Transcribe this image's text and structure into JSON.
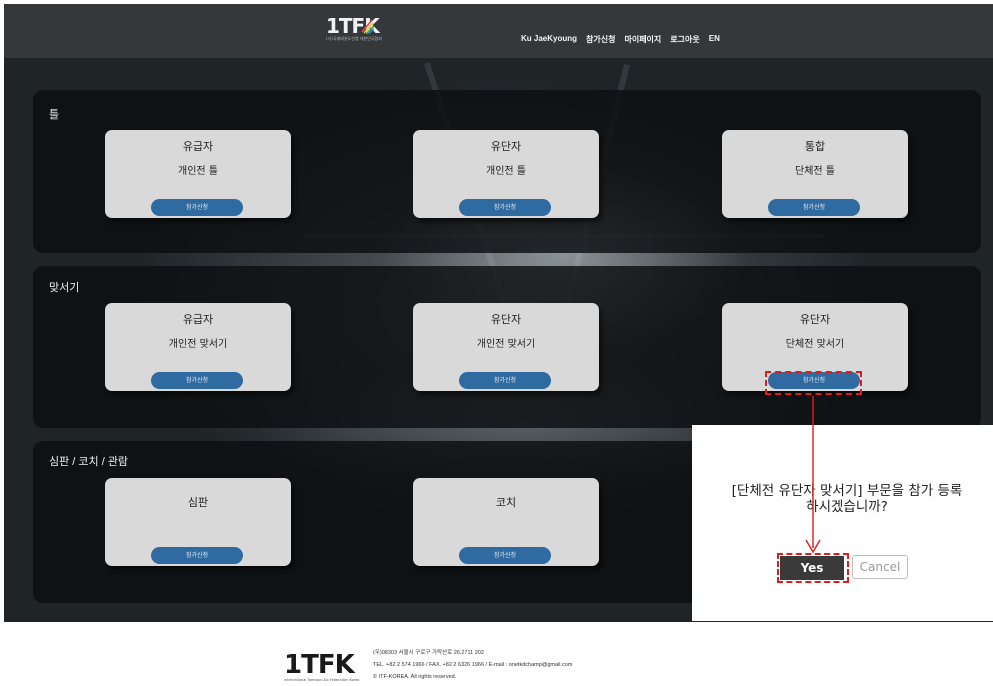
{
  "navbar": {
    "logo_text": "1TFK",
    "logo_subtext": "(사)국제태권도연맹 대한민국협회",
    "user_name": "Ku JaeKyoung",
    "links": [
      "참가신청",
      "마이페이지",
      "로그아웃",
      "EN"
    ]
  },
  "sections": [
    {
      "title": "틀",
      "cards": [
        {
          "category": "유급자",
          "event": "개인전 틀",
          "button": "참가신청"
        },
        {
          "category": "유단자",
          "event": "개인전 틀",
          "button": "참가신청"
        },
        {
          "category": "통합",
          "event": "단체전 틀",
          "button": "참가신청"
        }
      ]
    },
    {
      "title": "맞서기",
      "cards": [
        {
          "category": "유급자",
          "event": "개인전 맞서기",
          "button": "참가신청"
        },
        {
          "category": "유단자",
          "event": "개인전 맞서기",
          "button": "참가신청"
        },
        {
          "category": "유단자",
          "event": "단체전 맞서기",
          "button": "참가신청"
        }
      ]
    },
    {
      "title": "심판 / 코치 / 관람",
      "cards": [
        {
          "category": "심판",
          "button": "참가신청"
        },
        {
          "category": "코치",
          "button": "참가신청"
        }
      ]
    }
  ],
  "dialog": {
    "message_line1": "[단체전 유단자 맞서기] 부문을 참가 등록",
    "message_line2": "하시겠습니까?",
    "yes_label": "Yes",
    "cancel_label": "Cancel"
  },
  "footer": {
    "logo_text": "1TFK",
    "logo_subtext": "International Taekwon-Do Federation Korea",
    "address": "(우)08303 서울시 구로구 가락산로 26,2711 202",
    "contact": "TEL. +82 2 574 1966 / FAX. +82 2 6326 1966 / E-mail : onetkdchamp@gmail.com",
    "copyright": "© ITF-KOREA. All rights reserved."
  },
  "colors": {
    "navbar_bg": "#34383b",
    "button_blue": "#2f6aa0",
    "card_bg": "#d9d9d9",
    "highlight_red": "#e01b1b",
    "yes_button": "#3a3a3a"
  }
}
